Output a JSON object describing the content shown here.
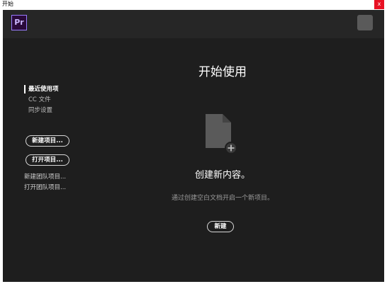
{
  "window": {
    "title": "开始",
    "close_glyph": "x"
  },
  "header": {
    "logo_text": "Pr"
  },
  "sidebar": {
    "nav": [
      {
        "label": "最近使用项",
        "active": true
      },
      {
        "label": "CC 文件",
        "active": false
      },
      {
        "label": "同步设置",
        "active": false
      }
    ],
    "buttons": {
      "new_project": "新建项目...",
      "open_project": "打开项目..."
    },
    "links": {
      "new_team_project": "新建团队项目...",
      "open_team_project": "打开团队项目..."
    }
  },
  "main": {
    "title": "开始使用",
    "icon": "new-document-plus-icon",
    "heading": "创建新内容。",
    "description": "通过创建空白文档开启一个新项目。",
    "new_button": "新建"
  },
  "colors": {
    "background": "#1e1e1e",
    "header": "#262626",
    "close": "#e81123",
    "logo_border": "#9a7cff"
  }
}
